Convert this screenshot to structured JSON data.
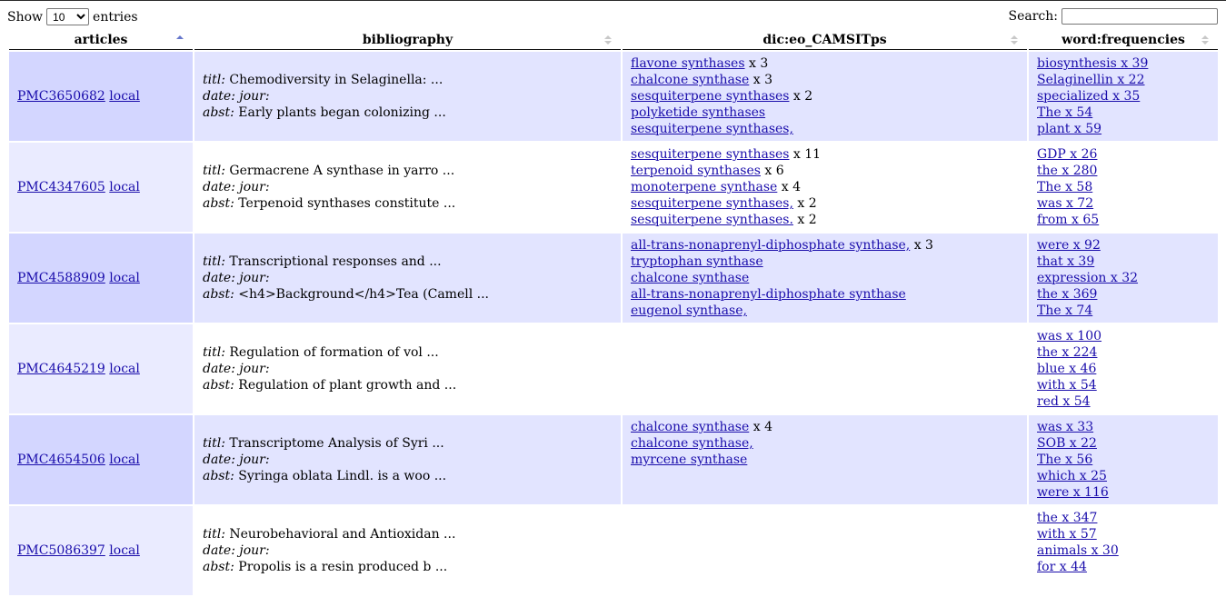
{
  "length_menu": {
    "show": "Show",
    "value": "10",
    "options": [
      "10"
    ],
    "entries": "entries"
  },
  "search": {
    "label": "Search:",
    "value": ""
  },
  "columns": [
    {
      "label": "articles",
      "sort": "asc"
    },
    {
      "label": "bibliography",
      "sort": "both"
    },
    {
      "label": "dic:eo_CAMSITps",
      "sort": "both"
    },
    {
      "label": "word:frequencies",
      "sort": "both"
    }
  ],
  "bib_labels": {
    "titl": "titl:",
    "date": "date: jour:",
    "abst": "abst:"
  },
  "rows": [
    {
      "pmc": "PMC3650682",
      "local": "local",
      "titl": "Chemodiversity in Selaginella: ...",
      "abst": "Early plants began colonizing ...",
      "dic": [
        {
          "link": "flavone synthases",
          "suffix": " x 3"
        },
        {
          "link": "chalcone synthase",
          "suffix": " x 3"
        },
        {
          "link": "sesquiterpene synthases",
          "suffix": " x 2"
        },
        {
          "link": "polyketide synthases",
          "suffix": ""
        },
        {
          "link": "sesquiterpene synthases,",
          "suffix": ""
        }
      ],
      "words": [
        "biosynthesis x 39",
        "Selaginellin x 22",
        "specialized x 35",
        "The x 54",
        "plant x 59"
      ]
    },
    {
      "pmc": "PMC4347605",
      "local": "local",
      "titl": "Germacrene A synthase in yarro ...",
      "abst": "Terpenoid synthases constitute ...",
      "dic": [
        {
          "link": "sesquiterpene synthases",
          "suffix": " x 11"
        },
        {
          "link": "terpenoid synthases",
          "suffix": " x 6"
        },
        {
          "link": "monoterpene synthase",
          "suffix": " x 4"
        },
        {
          "link": "sesquiterpene synthases,",
          "suffix": " x 2"
        },
        {
          "link": "sesquiterpene synthases.",
          "suffix": " x 2"
        }
      ],
      "words": [
        "GDP x 26",
        "the x 280",
        "The x 58",
        "was x 72",
        "from x 65"
      ]
    },
    {
      "pmc": "PMC4588909",
      "local": "local",
      "titl": "Transcriptional responses and ...",
      "abst": "<h4>Background</h4>Tea (Camell ...",
      "dic": [
        {
          "link": "all-trans-nonaprenyl-diphosphate synthase,",
          "suffix": " x 3"
        },
        {
          "link": "tryptophan synthase",
          "suffix": ""
        },
        {
          "link": "chalcone synthase",
          "suffix": ""
        },
        {
          "link": "all-trans-nonaprenyl-diphosphate synthase",
          "suffix": ""
        },
        {
          "link": "eugenol synthase,",
          "suffix": ""
        }
      ],
      "words": [
        "were x 92",
        "that x 39",
        "expression x 32",
        "the x 369",
        "The x 74"
      ]
    },
    {
      "pmc": "PMC4645219",
      "local": "local",
      "titl": "Regulation of formation of vol ...",
      "abst": "Regulation of plant growth and ...",
      "dic": [],
      "words": [
        "was x 100",
        "the x 224",
        "blue x 46",
        "with x 54",
        "red x 54"
      ]
    },
    {
      "pmc": "PMC4654506",
      "local": "local",
      "titl": "Transcriptome Analysis of Syri ...",
      "abst": "Syringa oblata Lindl. is a woo ...",
      "dic": [
        {
          "link": "chalcone synthase",
          "suffix": " x 4"
        },
        {
          "link": "chalcone synthase,",
          "suffix": ""
        },
        {
          "link": "myrcene synthase",
          "suffix": ""
        }
      ],
      "words": [
        "was x 33",
        "SOB x 22",
        "The x 56",
        "which x 25",
        "were x 116"
      ]
    },
    {
      "pmc": "PMC5086397",
      "local": "local",
      "titl": "Neurobehavioral and Antioxidan ...",
      "abst": "Propolis is a resin produced b ...",
      "dic": [],
      "words": [
        "the x 347",
        "with x 57",
        "animals x 30",
        "for x 44"
      ]
    }
  ]
}
